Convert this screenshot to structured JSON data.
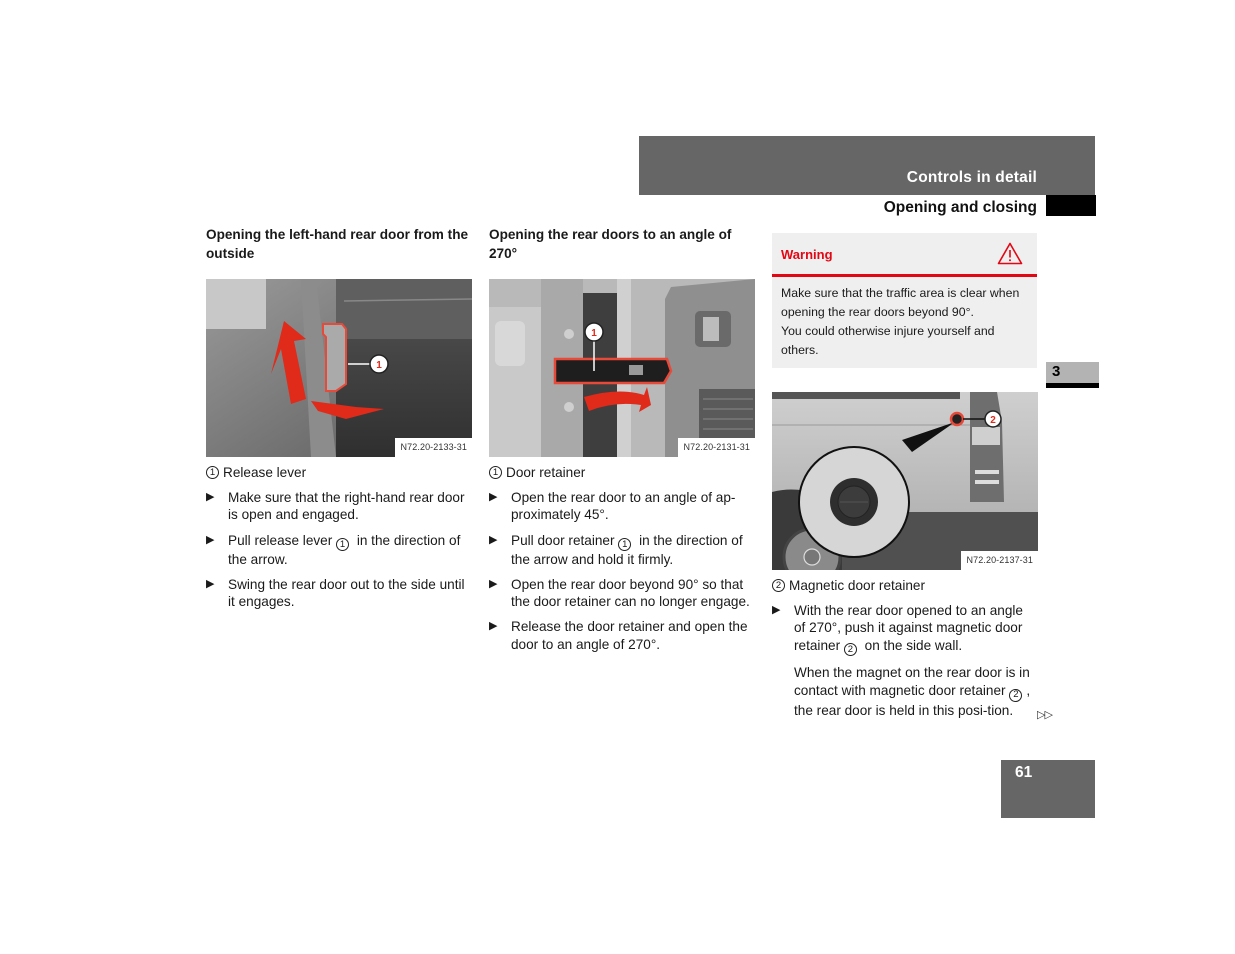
{
  "header": {
    "chapter": "Controls in detail",
    "section": "Opening and closing"
  },
  "chapter_tab": "3",
  "page_number": "61",
  "continue_marker": "▷▷",
  "columns": [
    {
      "title": "Opening the left-hand rear door from the outside",
      "figure": {
        "code": "N72.20-2133-31",
        "callouts": [
          "1"
        ],
        "description": "Release lever on the left-hand rear door with red arrows showing pull and swing directions"
      },
      "legend": {
        "num": "1",
        "label": "Release lever"
      },
      "steps": [
        {
          "text": "Make sure that the right-hand rear door is open and engaged."
        },
        {
          "pre": "Pull release lever ",
          "ref": "1",
          "post": " in the direction of the arrow."
        },
        {
          "text": "Swing the rear door out to the side until it engages."
        }
      ]
    },
    {
      "title": "Opening the rear doors to an angle of 270°",
      "figure": {
        "code": "N72.20-2131-31",
        "callouts": [
          "1"
        ],
        "description": "Door retainer strap highlighted in red with arrow showing pull direction"
      },
      "legend": {
        "num": "1",
        "label": "Door retainer"
      },
      "steps": [
        {
          "text": "Open the rear door to an angle of ap-proximately 45°."
        },
        {
          "pre": "Pull door retainer ",
          "ref": "1",
          "post": " in the direction of the arrow and hold it firmly."
        },
        {
          "text": "Open the rear door beyond 90° so that the door retainer can no longer engage."
        },
        {
          "text": "Release the door retainer and open the door to an angle of 270°."
        }
      ]
    },
    {
      "warning": {
        "title": "Warning",
        "icon": "warning-triangle-icon",
        "lines": [
          "Make sure that the traffic area is clear when opening the rear doors beyond 90°.",
          "You could otherwise injure yourself and others."
        ]
      },
      "figure": {
        "code": "N72.20-2137-31",
        "callouts": [
          "2"
        ],
        "description": "Rear side wall of van with magnified view of magnetic door retainer"
      },
      "legend": {
        "num": "2",
        "label": "Magnetic door retainer"
      },
      "steps": [
        {
          "pre": "With the rear door opened to an angle of 270°, push it against magnetic door retainer ",
          "ref": "2",
          "post": " on the side wall."
        }
      ],
      "note": {
        "pre": "When the magnet on the rear door is in contact with magnetic door retainer ",
        "ref": "2",
        "post": ", the rear door is held in this posi-tion."
      }
    }
  ],
  "colors": {
    "header_band": "#666666",
    "warning_red": "#e30613",
    "warning_bg": "#efefef",
    "tab_grey": "#b3b3b3"
  }
}
